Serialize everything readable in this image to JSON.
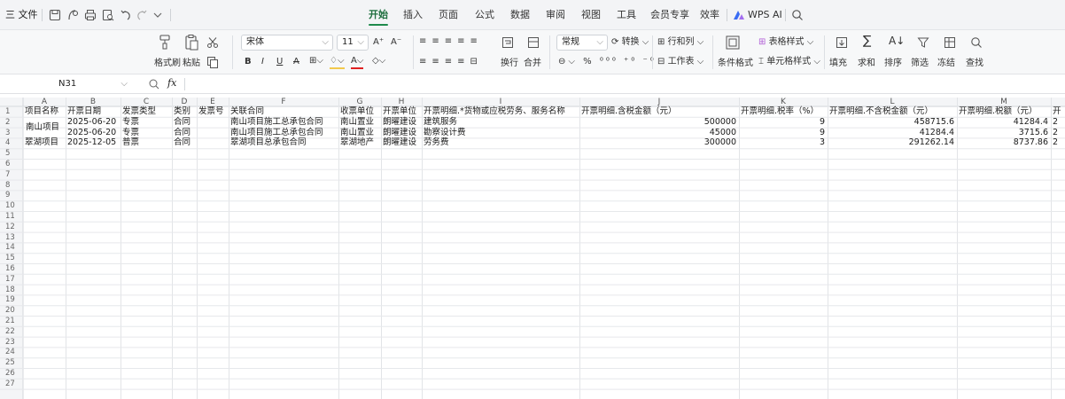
{
  "menubar": {
    "file_label": "三 文件",
    "tabs": [
      "开始",
      "插入",
      "页面",
      "公式",
      "数据",
      "审阅",
      "视图",
      "工具",
      "会员专享",
      "效率"
    ],
    "active_tab": "开始",
    "wps_ai_label": "WPS AI"
  },
  "ribbon": {
    "format_painter": "格式刷",
    "paste": "粘贴",
    "font_name": "宋体",
    "font_size": "11",
    "wrap": "换行",
    "merge": "合并",
    "number_format": "常规",
    "convert": "转换",
    "rows_cols": "行和列",
    "worksheet": "工作表",
    "cond_format": "条件格式",
    "table_style": "表格样式",
    "cell_style": "单元格样式",
    "fill": "填充",
    "sum": "求和",
    "sort": "排序",
    "filter": "筛选",
    "freeze": "冻结",
    "find": "查找"
  },
  "formula_bar": {
    "name_box": "N31",
    "fx": "fx"
  },
  "sheet": {
    "columns": [
      "A",
      "B",
      "C",
      "D",
      "E",
      "F",
      "G",
      "H",
      "I",
      "J",
      "K",
      "L",
      "M"
    ],
    "rows": [
      "1",
      "2",
      "3",
      "4",
      "5",
      "6",
      "7",
      "8",
      "9",
      "10",
      "11",
      "12",
      "13",
      "14",
      "15",
      "16",
      "17",
      "18",
      "19",
      "20",
      "21",
      "22",
      "23",
      "24",
      "25",
      "26",
      "27"
    ],
    "header_row": [
      "项目名称",
      "开票日期",
      "发票类型",
      "类别",
      "发票号",
      "关联合同",
      "收票单位",
      "开票单位",
      "开票明细.*货物或应税劳务、服务名称",
      "开票明细.含税金额（元）",
      "开票明细.税率（%）",
      "开票明细.不含税金额（元）",
      "开票明细.税额（元）"
    ],
    "data_rows": [
      [
        "南山项目",
        "2025-06-20",
        "专票",
        "合同",
        "",
        "南山项目施工总承包合同",
        "南山置业",
        "朗曜建设",
        "建筑服务",
        "500000",
        "9",
        "458715.6",
        "41284.4"
      ],
      [
        "",
        "2025-06-20",
        "专票",
        "合同",
        "",
        "南山项目施工总承包合同",
        "南山置业",
        "朗曜建设",
        "勘察设计费",
        "45000",
        "9",
        "41284.4",
        "3715.6"
      ],
      [
        "翠湖项目",
        "2025-12-05",
        "普票",
        "合同",
        "",
        "翠湖项目总承包合同",
        "翠湖地产",
        "朗曜建设",
        "劳务费",
        "300000",
        "3",
        "291262.14",
        "8737.86"
      ]
    ],
    "overflow_marks": [
      "2",
      "2",
      "2"
    ],
    "next_header_mark": "开"
  }
}
